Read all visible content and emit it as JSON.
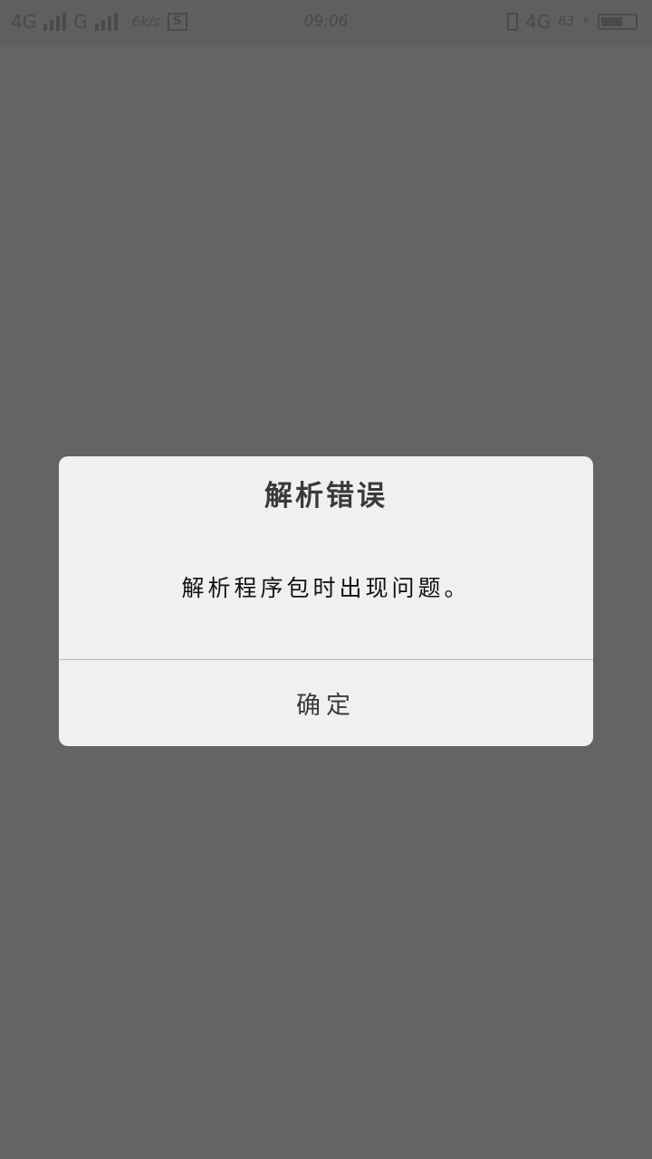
{
  "status_bar": {
    "sim1_network": "4G",
    "sim2_network": "G",
    "speed": "6k/s",
    "s_badge": "S",
    "time": "09:06",
    "mobile_data": "4G",
    "battery_percent": "63",
    "battery_level": 0.63,
    "icons": [
      "signal-bars-icon",
      "s-notification-icon",
      "vibrate-icon",
      "charging-icon",
      "battery-icon"
    ]
  },
  "dialog": {
    "title": "解析错误",
    "message": "解析程序包时出现问题。",
    "ok_label": "确定"
  },
  "colors": {
    "scrim": "#646464",
    "dialog_bg": "#f0f0f0",
    "text_dark": "#111111"
  }
}
